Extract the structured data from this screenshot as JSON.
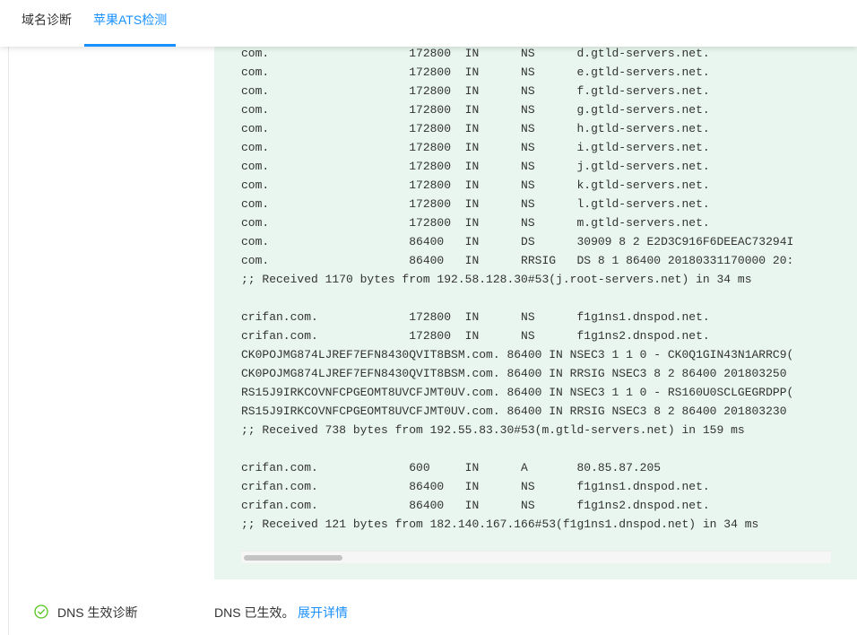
{
  "tabs": {
    "domain_diagnosis": "域名诊断",
    "ats_check": "苹果ATS检测",
    "active": "ats_check"
  },
  "dig_output": [
    "com.                    172800  IN      NS      d.gtld-servers.net.",
    "com.                    172800  IN      NS      e.gtld-servers.net.",
    "com.                    172800  IN      NS      f.gtld-servers.net.",
    "com.                    172800  IN      NS      g.gtld-servers.net.",
    "com.                    172800  IN      NS      h.gtld-servers.net.",
    "com.                    172800  IN      NS      i.gtld-servers.net.",
    "com.                    172800  IN      NS      j.gtld-servers.net.",
    "com.                    172800  IN      NS      k.gtld-servers.net.",
    "com.                    172800  IN      NS      l.gtld-servers.net.",
    "com.                    172800  IN      NS      m.gtld-servers.net.",
    "com.                    86400   IN      DS      30909 8 2 E2D3C916F6DEEAC73294I",
    "com.                    86400   IN      RRSIG   DS 8 1 86400 20180331170000 20:",
    ";; Received 1170 bytes from 192.58.128.30#53(j.root-servers.net) in 34 ms",
    "",
    "crifan.com.             172800  IN      NS      f1g1ns1.dnspod.net.",
    "crifan.com.             172800  IN      NS      f1g1ns2.dnspod.net.",
    "CK0POJMG874LJREF7EFN8430QVIT8BSM.com. 86400 IN NSEC3 1 1 0 - CK0Q1GIN43N1ARRC9(",
    "CK0POJMG874LJREF7EFN8430QVIT8BSM.com. 86400 IN RRSIG NSEC3 8 2 86400 201803250",
    "RS15J9IRKCOVNFCPGEOMT8UVCFJMT0UV.com. 86400 IN NSEC3 1 1 0 - RS160U0SCLGEGRDPP(",
    "RS15J9IRKCOVNFCPGEOMT8UVCFJMT0UV.com. 86400 IN RRSIG NSEC3 8 2 86400 201803230",
    ";; Received 738 bytes from 192.55.83.30#53(m.gtld-servers.net) in 159 ms",
    "",
    "crifan.com.             600     IN      A       80.85.87.205",
    "crifan.com.             86400   IN      NS      f1g1ns1.dnspod.net.",
    "crifan.com.             86400   IN      NS      f1g1ns2.dnspod.net.",
    ";; Received 121 bytes from 182.140.167.166#53(f1g1ns1.dnspod.net) in 34 ms"
  ],
  "dns_status": {
    "icon": "check-circle-icon",
    "label": "DNS 生效诊断",
    "text": "DNS 已生效。",
    "link": "展开详情"
  },
  "colors": {
    "accent": "#1890ff",
    "success": "#52c41a",
    "code_bg": "#e8f6ef"
  }
}
